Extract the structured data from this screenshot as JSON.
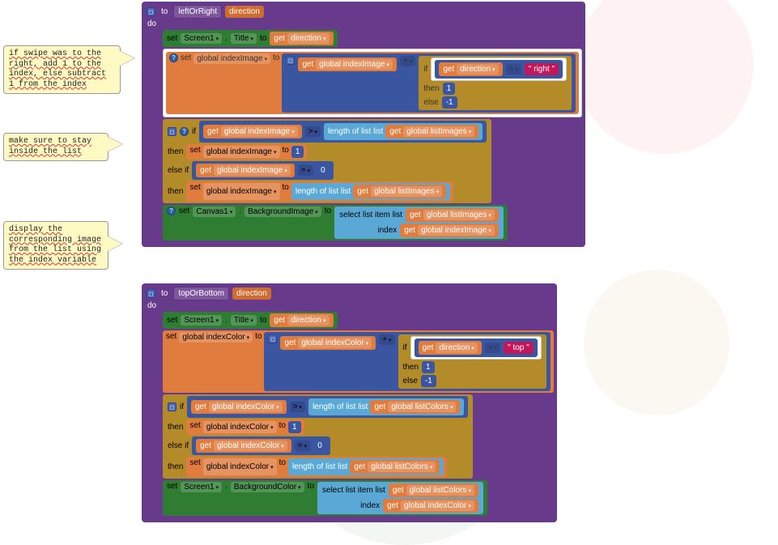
{
  "kw": {
    "to": "to",
    "do": "do",
    "set": "set",
    "get": "get",
    "if": "if",
    "then": "then",
    "else": "else",
    "elseif": "else if",
    "plus": "+",
    "eq": "= ",
    "gt": "> ",
    "lenlist": "length of list  list",
    "sellist": "select list item  list",
    "index": "index",
    "toKw": "to"
  },
  "comments": {
    "c1": "if swipe was to the right, add 1 to the index, else subtract 1 from the index",
    "c2": "make sure to stay inside the list",
    "c3": "display the corresponding image from the list using the index variable"
  },
  "proc1": {
    "name": "leftOrRight",
    "param": "direction",
    "screenComp": "Screen1",
    "titleProp": "Title",
    "dirVar": "direction",
    "indexVar": "global indexImage",
    "listVar": "global listImages",
    "rightStr": "\"  right  \"",
    "one": "1",
    "negone": "-1",
    "zero": "0",
    "canvasComp": "Canvas1",
    "bgProp": "BackgroundImage"
  },
  "proc2": {
    "name": "topOrBottom",
    "param": "direction",
    "screenComp": "Screen1",
    "titleProp": "Title",
    "dirVar": "direction",
    "indexVar": "global indexColor",
    "listVar": "global listColors",
    "topStr": "\"  top  \"",
    "one": "1",
    "negone": "-1",
    "zero": "0",
    "bgcolorProp": "BackgroundColor"
  }
}
